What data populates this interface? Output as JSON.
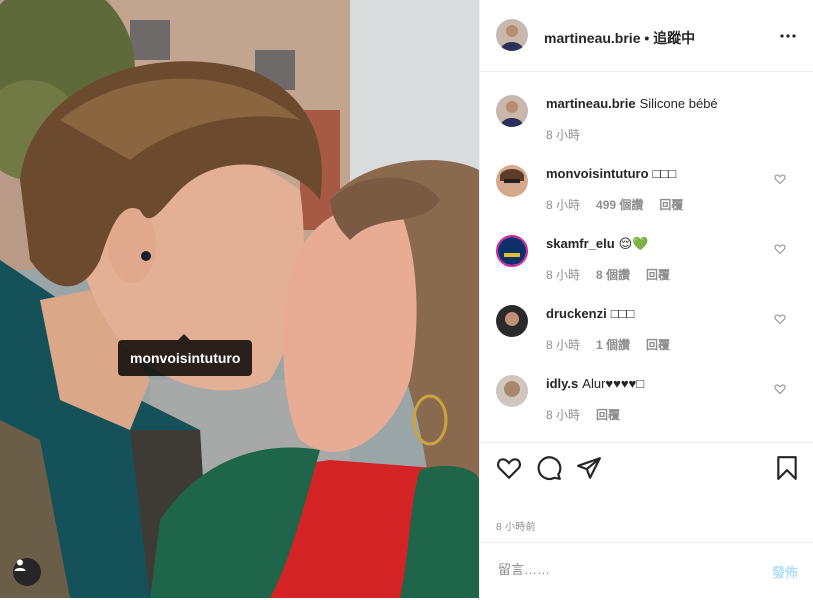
{
  "photo": {
    "tag_username": "monvoisintuturo",
    "user_tag_icon": "person-icon"
  },
  "header": {
    "username": "martineau.brie",
    "separator": " • ",
    "follow_status": "追蹤中",
    "more_icon": "more-horizontal-icon"
  },
  "caption": {
    "username": "martineau.brie",
    "text": "Silicone bébé",
    "time": "8 小時"
  },
  "comments": [
    {
      "username": "monvoisintuturo",
      "text": "□□□",
      "time": "8 小時",
      "likes": "499 個讚",
      "reply": "回覆"
    },
    {
      "username": "skamfr_elu",
      "text": "😌💚",
      "time": "8 小時",
      "likes": "8 個讚",
      "reply": "回覆"
    },
    {
      "username": "druckenzi",
      "text": "□□□",
      "time": "8 小時",
      "likes": "1 個讚",
      "reply": "回覆"
    },
    {
      "username": "idly.s",
      "text": "Alur♥♥♥♥□",
      "time": "8 小時",
      "likes": "",
      "reply": "回覆"
    }
  ],
  "actions": [
    "heart-icon",
    "comment-icon",
    "share-icon",
    "bookmark-icon"
  ],
  "timestamp": "8 小時前",
  "add_comment": {
    "placeholder": "留言……",
    "post_label": "發佈"
  }
}
